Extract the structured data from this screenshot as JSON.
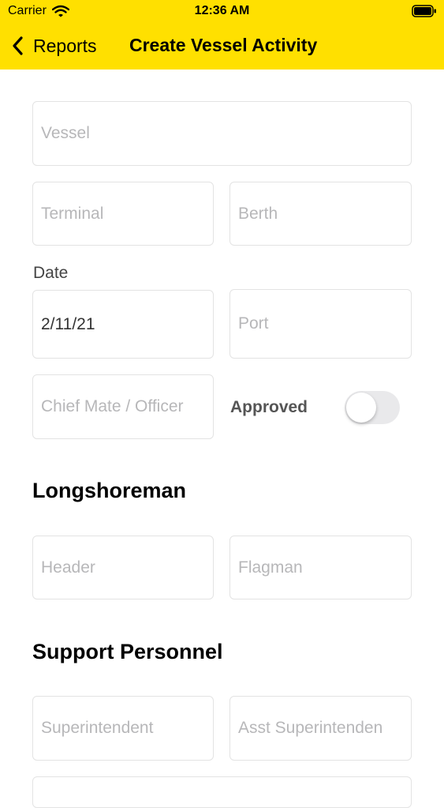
{
  "status_bar": {
    "carrier": "Carrier",
    "time": "12:36 AM"
  },
  "nav": {
    "back_label": "Reports",
    "title": "Create Vessel Activity"
  },
  "form": {
    "vessel": {
      "placeholder": "Vessel"
    },
    "terminal": {
      "placeholder": "Terminal"
    },
    "berth": {
      "placeholder": "Berth"
    },
    "date": {
      "label": "Date",
      "value": "2/11/21"
    },
    "port": {
      "placeholder": "Port"
    },
    "chief_mate": {
      "placeholder": "Chief Mate / Officer"
    },
    "approved": {
      "label": "Approved",
      "on": false
    }
  },
  "longshoreman": {
    "title": "Longshoreman",
    "header": {
      "placeholder": "Header"
    },
    "flagman": {
      "placeholder": "Flagman"
    }
  },
  "support_personnel": {
    "title": "Support Personnel",
    "superintendent": {
      "placeholder": "Superintendent"
    },
    "asst_superintendent": {
      "placeholder": "Asst Superintenden"
    }
  },
  "colors": {
    "nav_bar": "#FFE000",
    "placeholder": "#b7b7b9",
    "field_border": "#e3e3e3"
  },
  "icons": {
    "back": "chevron-left-icon",
    "wifi": "wifi-icon",
    "battery": "battery-icon"
  }
}
